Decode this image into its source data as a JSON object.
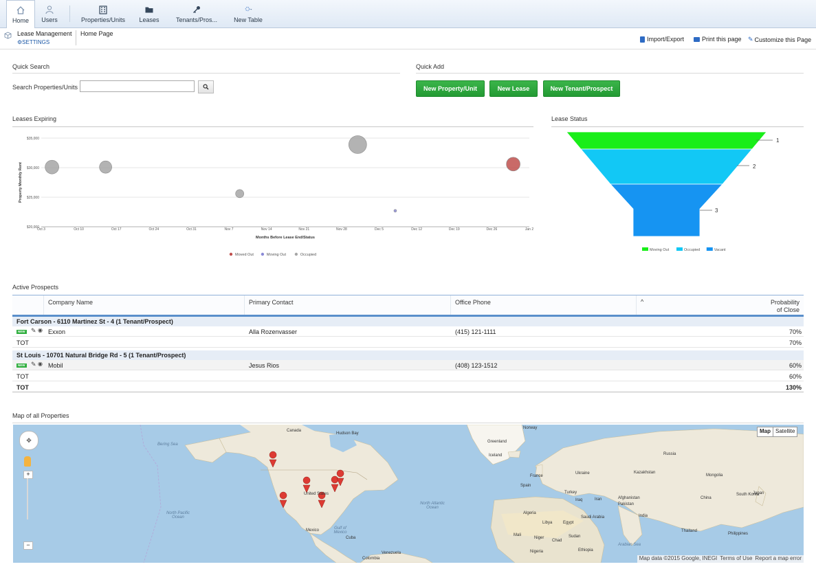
{
  "nav": {
    "tabs": [
      {
        "label": "Home",
        "icon": "home-icon"
      },
      {
        "label": "Users",
        "icon": "user-icon"
      },
      {
        "label": "Properties/Units",
        "icon": "building-icon"
      },
      {
        "label": "Leases",
        "icon": "folder-icon"
      },
      {
        "label": "Tenants/Pros...",
        "icon": "key-icon"
      },
      {
        "label": "New Table",
        "icon": "gear-icon"
      }
    ]
  },
  "breadcrumb": {
    "app": "Lease Management",
    "settings": "SETTINGS",
    "page": "Home Page"
  },
  "actions": {
    "import_export": "Import/Export",
    "print": "Print this page",
    "customize": "Customize this Page"
  },
  "quick_search": {
    "title": "Quick Search",
    "label": "Search Properties/Units",
    "value": ""
  },
  "quick_add": {
    "title": "Quick Add",
    "buttons": [
      "New Property/Unit",
      "New Lease",
      "New Tenant/Prospect"
    ]
  },
  "leases_expiring": {
    "title": "Leases Expiring"
  },
  "lease_status": {
    "title": "Lease Status"
  },
  "chart_data": [
    {
      "type": "scatter",
      "title": "",
      "xlabel": "Months Before Lease End/Status",
      "ylabel": "Property Monthly Rent",
      "x_ticks": [
        "Oct 3",
        "Oct 10",
        "Oct 17",
        "Oct 24",
        "Oct 31",
        "Nov 7",
        "Nov 14",
        "Nov 21",
        "Nov 28",
        "Dec 5",
        "Dec 12",
        "Dec 19",
        "Dec 26",
        "Jan 2"
      ],
      "y_ticks": [
        "$20,000",
        "$25,000",
        "$30,000",
        "$35,000"
      ],
      "ylim": [
        20000,
        35000
      ],
      "legend_position": "bottom",
      "grid": true,
      "series": [
        {
          "name": "Moved Out",
          "color": "#c0504d",
          "points": [
            {
              "x": "Dec 30",
              "y": 30600,
              "size": 10
            }
          ]
        },
        {
          "name": "Moving Out",
          "color": "#8a8ad6",
          "points": [
            {
              "x": "Dec 8",
              "y": 22700,
              "size": 2
            }
          ]
        },
        {
          "name": "Occupied",
          "color": "#a6a6a6",
          "points": [
            {
              "x": "Oct 5",
              "y": 30100,
              "size": 10
            },
            {
              "x": "Oct 15",
              "y": 30100,
              "size": 9
            },
            {
              "x": "Nov 9",
              "y": 25600,
              "size": 6
            },
            {
              "x": "Dec 1",
              "y": 33900,
              "size": 13
            }
          ]
        }
      ]
    },
    {
      "type": "funnel",
      "title": "",
      "stages": [
        {
          "name": "Moving Out",
          "label": "1",
          "color": "#19ee19"
        },
        {
          "name": "Occupied",
          "label": "2",
          "color": "#12c8f5"
        },
        {
          "name": "Vacant",
          "label": "3",
          "color": "#1694f2"
        }
      ],
      "legend_position": "bottom"
    }
  ],
  "prospects": {
    "title": "Active Prospects",
    "columns": [
      "Company Name",
      "Primary Contact",
      "Office Phone",
      "Probability of Close"
    ],
    "sort_indicator": "^",
    "groups": [
      {
        "header": "Fort Carson - 6110 Martinez St - 4  (1 Tenant/Prospect)",
        "rows": [
          {
            "company": "Exxon",
            "contact": "Alla Rozenvasser",
            "phone": "(415) 121-1111",
            "prob": "70%"
          }
        ],
        "tot_label": "TOT",
        "tot": "70%"
      },
      {
        "header": "St Louis - 10701 Natural Bridge Rd - 5  (1 Tenant/Prospect)",
        "rows": [
          {
            "company": "Mobil",
            "contact": "Jesus Rios",
            "phone": "(408) 123-1512",
            "prob": "60%"
          }
        ],
        "tot_label": "TOT",
        "tot": "60%"
      }
    ],
    "grand_total_label": "TOT",
    "grand_total": "130%",
    "badge": "NEW"
  },
  "map": {
    "title": "Map of all Properties",
    "map_btn": "Map",
    "satellite_btn": "Satellite",
    "attribution": "Map data ©2015 Google, INEGI",
    "terms": "Terms of Use",
    "report": "Report a map error",
    "labels": {
      "canada": "Canada",
      "hudson": "Hudson Bay",
      "us": "United States",
      "mexico": "Mexico",
      "greenland": "Greenland",
      "iceland": "Iceland",
      "norway": "Norway",
      "russia": "Russia",
      "kazakhstan": "Kazakhstan",
      "mongolia": "Mongolia",
      "china": "China",
      "japan": "Japan",
      "india": "India",
      "libya": "Libya",
      "egypt": "Egypt",
      "algeria": "Algeria",
      "mali": "Mali",
      "niger": "Niger",
      "chad": "Chad",
      "sudan": "Sudan",
      "nigeria": "Nigeria",
      "ethiopia": "Ethiopia",
      "france": "France",
      "spain": "Spain",
      "ukraine": "Ukraine",
      "turkey": "Turkey",
      "iran": "Iran",
      "iraq": "Iraq",
      "saudi": "Saudi Arabia",
      "pakistan": "Pakistan",
      "afghanistan": "Afghanistan",
      "thailand": "Thailand",
      "philippines": "Philippines",
      "south_korea": "South Korea",
      "cuba": "Cuba",
      "venezuela": "Venezuela",
      "colombia": "Colombia",
      "bering": "Bering Sea",
      "north_pacific": "North Pacific Ocean",
      "north_atlantic": "North Atlantic Ocean",
      "gulf_mexico": "Gulf of Mexico",
      "arabian_sea": "Arabian Sea"
    }
  }
}
